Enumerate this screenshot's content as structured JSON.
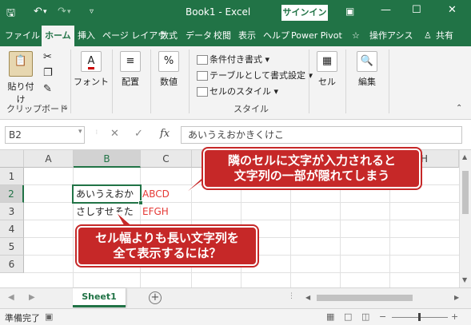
{
  "titlebar": {
    "save_icon": "save-icon",
    "undo_icon": "undo-icon",
    "redo_icon": "redo-icon",
    "customize_icon": "customize-qat-icon",
    "title": "Book1 - Excel",
    "signin": "サインイン",
    "ribbon_display_icon": "ribbon-display-icon",
    "minimize": "—",
    "maximize": "☐",
    "close": "✕"
  },
  "tabs": [
    "ファイル",
    "ホーム",
    "挿入",
    "ページ レイアウ",
    "数式",
    "データ",
    "校閲",
    "表示",
    "ヘルプ",
    "Power Pivot",
    "操作アシス",
    "共有"
  ],
  "ribbon": {
    "paste_label": "貼り付け",
    "clipboard_group": "クリップボード",
    "font_label": "フォント",
    "alignment_label": "配置",
    "number_label": "数値",
    "cond_format": "条件付き書式",
    "table_format": "テーブルとして書式設定",
    "cell_style": "セルのスタイル",
    "styles_group": "スタイル",
    "cells_label": "セル",
    "editing_label": "編集"
  },
  "formula_bar": {
    "name_box": "B2",
    "cancel": "✕",
    "enter": "✓",
    "fx": "fx",
    "value": "あいうえおかきくけこ"
  },
  "grid": {
    "columns": [
      "A",
      "B",
      "C",
      "D",
      "E",
      "F",
      "G",
      "H"
    ],
    "rows": [
      "1",
      "2",
      "3",
      "4",
      "5",
      "6"
    ],
    "b2_text": "あいうえおか",
    "c2_text": "ABCD",
    "b3_text": "さしすせそた",
    "c3_text": "EFGH"
  },
  "sheet_tabs": {
    "active": "Sheet1",
    "add": "+"
  },
  "status": {
    "ready": "準備完了"
  },
  "callouts": {
    "top": [
      "隣のセルに文字が入力されると",
      "文字列の一部が隠れてしまう"
    ],
    "bottom": [
      "セル幅よりも長い文字列を",
      "全て表示するには？"
    ]
  },
  "colors": {
    "excel_green": "#217346",
    "callout_red": "#c62828",
    "text_red": "#e53935"
  }
}
